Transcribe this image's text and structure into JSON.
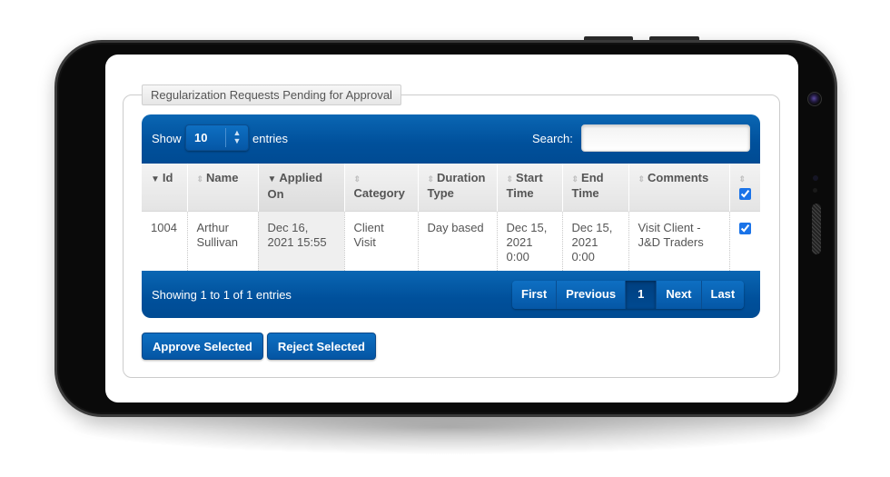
{
  "panel": {
    "legend": "Regularization Requests Pending for Approval"
  },
  "table_controls": {
    "show_label": "Show",
    "entries_label": "entries",
    "page_size": "10",
    "search_label": "Search:",
    "search_value": "",
    "search_placeholder": ""
  },
  "table": {
    "columns": [
      {
        "label_line1": "Id",
        "label_line2": "",
        "sort": "desc-active"
      },
      {
        "label_line1": "Name",
        "label_line2": "",
        "sort": "both"
      },
      {
        "label_line1": "Applied",
        "label_line2": "On",
        "sort": "desc-active"
      },
      {
        "label_line1": "",
        "label_line2": "Category",
        "sort": "both"
      },
      {
        "label_line1": "Duration",
        "label_line2": "Type",
        "sort": "both"
      },
      {
        "label_line1": "Start",
        "label_line2": "Time",
        "sort": "both"
      },
      {
        "label_line1": "End",
        "label_line2": "Time",
        "sort": "both"
      },
      {
        "label_line1": "Comments",
        "label_line2": "",
        "sort": "both"
      },
      {
        "label_line1": "",
        "label_line2": "",
        "sort": "both",
        "select_all_checked": true
      }
    ],
    "rows": [
      {
        "id": "1004",
        "name_l1": "Arthur",
        "name_l2": "Sullivan",
        "applied_l1": "Dec 16,",
        "applied_l2": "2021 15:55",
        "category_l1": "Client",
        "category_l2": "Visit",
        "duration_type": "Day based",
        "start_l1": "Dec 15,",
        "start_l2": "2021",
        "start_l3": "0:00",
        "end_l1": "Dec 15,",
        "end_l2": "2021",
        "end_l3": "0:00",
        "comments_l1": "Visit Client -",
        "comments_l2": "J&D Traders",
        "selected": true
      }
    ]
  },
  "footer": {
    "info": "Showing 1 to 1 of 1 entries",
    "pagination": {
      "first": "First",
      "previous": "Previous",
      "current": "1",
      "next": "Next",
      "last": "Last"
    }
  },
  "actions": {
    "approve": "Approve Selected",
    "reject": "Reject Selected"
  },
  "icons": {
    "sort_both": "⇕",
    "sort_desc": "▼",
    "select_arrows": "⬍"
  },
  "colors": {
    "primary": "#0557a6",
    "header_bg": "#e8e8e8",
    "text": "#555555"
  }
}
